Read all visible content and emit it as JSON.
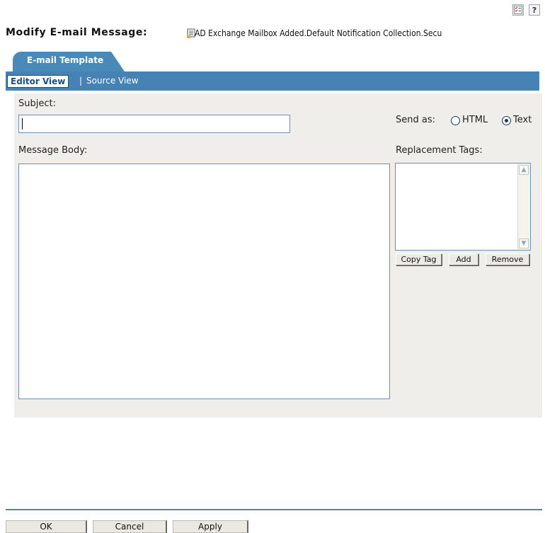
{
  "header": {
    "title": "Modify E-mail Message:",
    "object_name": "AD Exchange Mailbox Added.Default Notification Collection.Secu"
  },
  "top_icons": {
    "checklist_glyph": "☑",
    "help_glyph": "?"
  },
  "tab": {
    "label": "E-mail Template"
  },
  "views": {
    "editor_view": "Editor View",
    "separator": "|",
    "source_view": "Source View"
  },
  "form": {
    "subject_label": "Subject:",
    "subject_value": "",
    "send_as_label": "Send as:",
    "send_as_options": [
      {
        "label": "HTML",
        "checked": false
      },
      {
        "label": "Text",
        "checked": true
      }
    ],
    "message_body_label": "Message Body:",
    "message_body_value": "",
    "replacement_tags_label": "Replacement Tags:",
    "replacement_tags": []
  },
  "tag_buttons": {
    "copy_tag": "Copy Tag",
    "add": "Add",
    "remove": "Remove"
  },
  "footer": {
    "ok": "OK",
    "cancel": "Cancel",
    "apply": "Apply"
  },
  "colors": {
    "accent": "#4682b4",
    "panel": "#efeeea",
    "footer_rule": "#5a7fa8"
  }
}
